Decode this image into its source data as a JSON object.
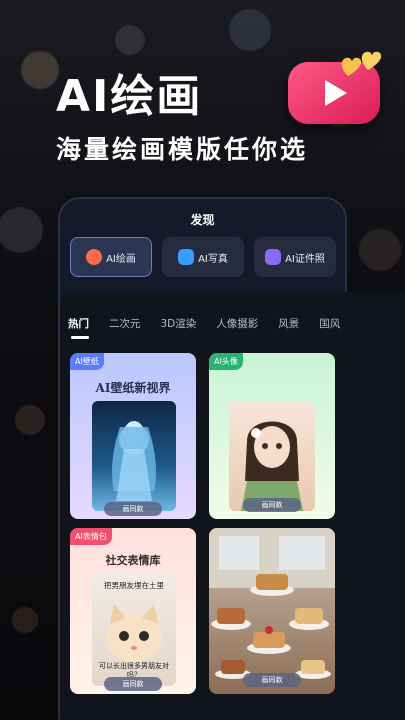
{
  "hero": {
    "title": "AI绘画",
    "subtitle": "海量绘画模版任你选"
  },
  "phone": {
    "title": "发现",
    "tools": [
      {
        "label": "AI绘画",
        "icon": "palette-icon"
      },
      {
        "label": "AI写真",
        "icon": "portrait-icon"
      },
      {
        "label": "AI证件照",
        "icon": "id-photo-icon"
      }
    ]
  },
  "tabs": [
    "热门",
    "二次元",
    "3D渲染",
    "人像摄影",
    "风景",
    "国风"
  ],
  "cards": [
    {
      "badge": "AI壁纸",
      "heading": "AI壁纸新视界",
      "button": "画同款"
    },
    {
      "badge": "AI头像",
      "heading": "",
      "button": "画同款"
    },
    {
      "badge": "AI表情包",
      "heading": "社交表情库",
      "caption_top": "把男朋友埋在土里",
      "caption_bottom": "可以长出很多男朋友对吗？",
      "button": "画同款"
    },
    {
      "badge": "",
      "heading": "",
      "button": "画同款"
    }
  ],
  "colors": {
    "accent_pink": "#e8286a",
    "badge_blue": "#5b7cff",
    "badge_green": "#27b472",
    "badge_red": "#f0506e"
  }
}
